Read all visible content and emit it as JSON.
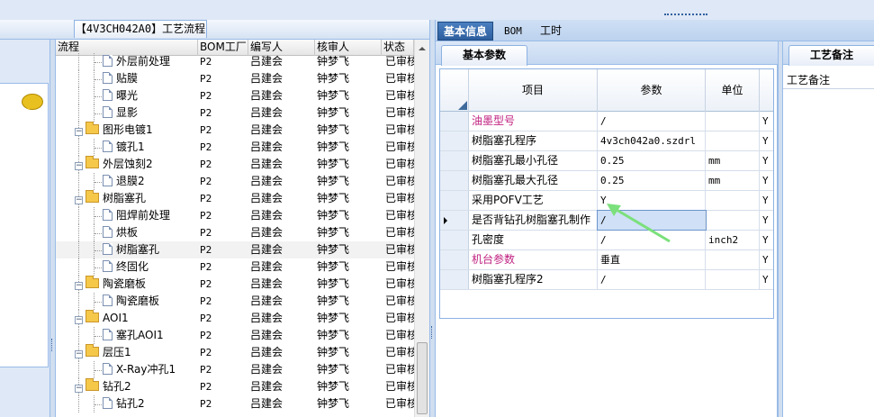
{
  "flow_tab": {
    "title": "【4V3CH042A0】工艺流程"
  },
  "tree": {
    "columns": [
      "流程",
      "BOM工厂",
      "编写人",
      "核审人",
      "状态"
    ],
    "rows": [
      {
        "name": "外层前处理",
        "kind": "doc",
        "level": 2,
        "bom": "P2",
        "writer": "吕建会",
        "reviewer": "钟梦飞",
        "status": "已审核"
      },
      {
        "name": "贴膜",
        "kind": "doc",
        "level": 2,
        "bom": "P2",
        "writer": "吕建会",
        "reviewer": "钟梦飞",
        "status": "已审核"
      },
      {
        "name": "曝光",
        "kind": "doc",
        "level": 2,
        "bom": "P2",
        "writer": "吕建会",
        "reviewer": "钟梦飞",
        "status": "已审核"
      },
      {
        "name": "显影",
        "kind": "doc",
        "level": 2,
        "bom": "P2",
        "writer": "吕建会",
        "reviewer": "钟梦飞",
        "status": "已审核"
      },
      {
        "name": "图形电镀1",
        "kind": "folder",
        "level": 1,
        "bom": "P2",
        "writer": "吕建会",
        "reviewer": "钟梦飞",
        "status": "已审核"
      },
      {
        "name": "镀孔1",
        "kind": "doc",
        "level": 2,
        "bom": "P2",
        "writer": "吕建会",
        "reviewer": "钟梦飞",
        "status": "已审核"
      },
      {
        "name": "外层蚀刻2",
        "kind": "folder",
        "level": 1,
        "bom": "P2",
        "writer": "吕建会",
        "reviewer": "钟梦飞",
        "status": "已审核"
      },
      {
        "name": "退膜2",
        "kind": "doc",
        "level": 2,
        "bom": "P2",
        "writer": "吕建会",
        "reviewer": "钟梦飞",
        "status": "已审核"
      },
      {
        "name": "树脂塞孔",
        "kind": "folder",
        "level": 1,
        "bom": "P2",
        "writer": "吕建会",
        "reviewer": "钟梦飞",
        "status": "已审核"
      },
      {
        "name": "阻焊前处理",
        "kind": "doc",
        "level": 2,
        "bom": "P2",
        "writer": "吕建会",
        "reviewer": "钟梦飞",
        "status": "已审核"
      },
      {
        "name": "烘板",
        "kind": "doc",
        "level": 2,
        "bom": "P2",
        "writer": "吕建会",
        "reviewer": "钟梦飞",
        "status": "已审核"
      },
      {
        "name": "树脂塞孔",
        "kind": "doc",
        "level": 2,
        "bom": "P2",
        "writer": "吕建会",
        "reviewer": "钟梦飞",
        "status": "已审核",
        "selected": true
      },
      {
        "name": "终固化",
        "kind": "doc",
        "level": 2,
        "bom": "P2",
        "writer": "吕建会",
        "reviewer": "钟梦飞",
        "status": "已审核"
      },
      {
        "name": "陶瓷磨板",
        "kind": "folder",
        "level": 1,
        "bom": "P2",
        "writer": "吕建会",
        "reviewer": "钟梦飞",
        "status": "已审核"
      },
      {
        "name": "陶瓷磨板",
        "kind": "doc",
        "level": 2,
        "bom": "P2",
        "writer": "吕建会",
        "reviewer": "钟梦飞",
        "status": "已审核"
      },
      {
        "name": "AOI1",
        "kind": "folder",
        "level": 1,
        "bom": "P2",
        "writer": "吕建会",
        "reviewer": "钟梦飞",
        "status": "已审核"
      },
      {
        "name": "塞孔AOI1",
        "kind": "doc",
        "level": 2,
        "bom": "P2",
        "writer": "吕建会",
        "reviewer": "钟梦飞",
        "status": "已审核"
      },
      {
        "name": "层压1",
        "kind": "folder",
        "level": 1,
        "bom": "P2",
        "writer": "吕建会",
        "reviewer": "钟梦飞",
        "status": "已审核"
      },
      {
        "name": "X-Ray冲孔1",
        "kind": "doc",
        "level": 2,
        "bom": "P2",
        "writer": "吕建会",
        "reviewer": "钟梦飞",
        "status": "已审核"
      },
      {
        "name": "钻孔2",
        "kind": "folder",
        "level": 1,
        "bom": "P2",
        "writer": "吕建会",
        "reviewer": "钟梦飞",
        "status": "已审核"
      },
      {
        "name": "钻孔2",
        "kind": "doc",
        "level": 2,
        "bom": "P2",
        "writer": "吕建会",
        "reviewer": "钟梦飞",
        "status": "已审核"
      }
    ]
  },
  "tabs": [
    {
      "label": "基本信息",
      "active": true
    },
    {
      "label": "BOM",
      "active": false
    },
    {
      "label": "工时",
      "active": false
    }
  ],
  "basic_params": {
    "tab_label": "基本参数",
    "headers": {
      "item": "项目",
      "param": "参数",
      "unit": "单位"
    },
    "rows": [
      {
        "item": "油墨型号",
        "param": "/",
        "unit": "",
        "flag": "Y",
        "highlight": true
      },
      {
        "item": "树脂塞孔程序",
        "param": "4v3ch042a0.szdrl",
        "unit": "",
        "flag": "Y"
      },
      {
        "item": "树脂塞孔最小孔径",
        "param": "0.25",
        "unit": "mm",
        "flag": "Y"
      },
      {
        "item": "树脂塞孔最大孔径",
        "param": "0.25",
        "unit": "mm",
        "flag": "Y"
      },
      {
        "item": "采用POFV工艺",
        "param": "Y",
        "unit": "",
        "flag": "Y"
      },
      {
        "item": "是否背钻孔树脂塞孔制作",
        "param": "/",
        "unit": "",
        "flag": "Y",
        "current": true
      },
      {
        "item": "孔密度",
        "param": "/",
        "unit": "inch2",
        "flag": "Y"
      },
      {
        "item": "机台参数",
        "param": "垂直",
        "unit": "",
        "flag": "Y",
        "highlight": true
      },
      {
        "item": "树脂塞孔程序2",
        "param": "/",
        "unit": "",
        "flag": "Y"
      }
    ]
  },
  "notes": {
    "tab_label": "工艺备注",
    "label": "工艺备注"
  },
  "colors": {
    "highlight_text": "#c02080",
    "active_tab": "#2d5e9e",
    "annotation_arrow": "#7be07b"
  }
}
